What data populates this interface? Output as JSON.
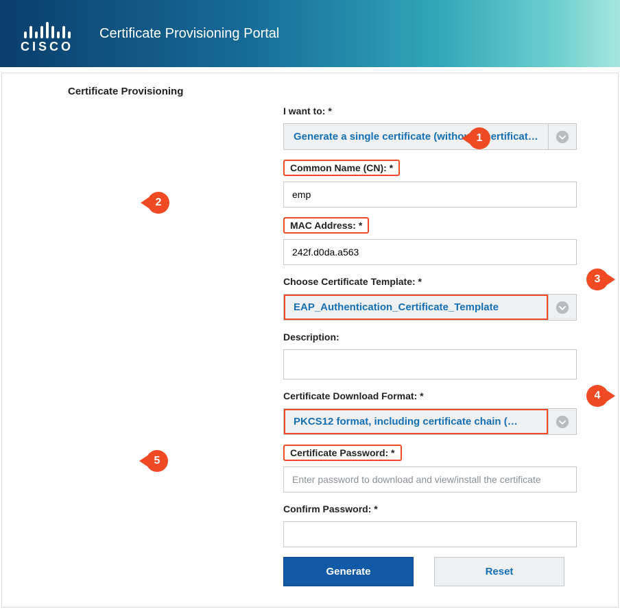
{
  "header": {
    "brand": "CISCO",
    "title": "Certificate Provisioning Portal"
  },
  "section_title": "Certificate Provisioning",
  "labels": {
    "i_want_to": "I want to: *",
    "common_name": "Common Name (CN): *",
    "mac_address": "MAC Address: *",
    "template": "Choose Certificate Template: *",
    "description": "Description:",
    "download_format": "Certificate Download Format: *",
    "cert_password": "Certificate Password: *",
    "confirm_password": "Confirm Password: *"
  },
  "values": {
    "i_want_to_selected": "Generate a single certificate (without a certificat…",
    "common_name": "emp",
    "mac_address": "242f.d0da.a563",
    "template_selected": "EAP_Authentication_Certificate_Template",
    "description": "",
    "download_format_selected": "PKCS12 format, including certificate chain (…",
    "cert_password": "",
    "confirm_password": ""
  },
  "placeholders": {
    "cert_password": "Enter password to download and view/install the certificate"
  },
  "buttons": {
    "generate": "Generate",
    "reset": "Reset"
  },
  "callouts": {
    "c1": "1",
    "c2": "2",
    "c3": "3",
    "c4": "4",
    "c5": "5"
  }
}
